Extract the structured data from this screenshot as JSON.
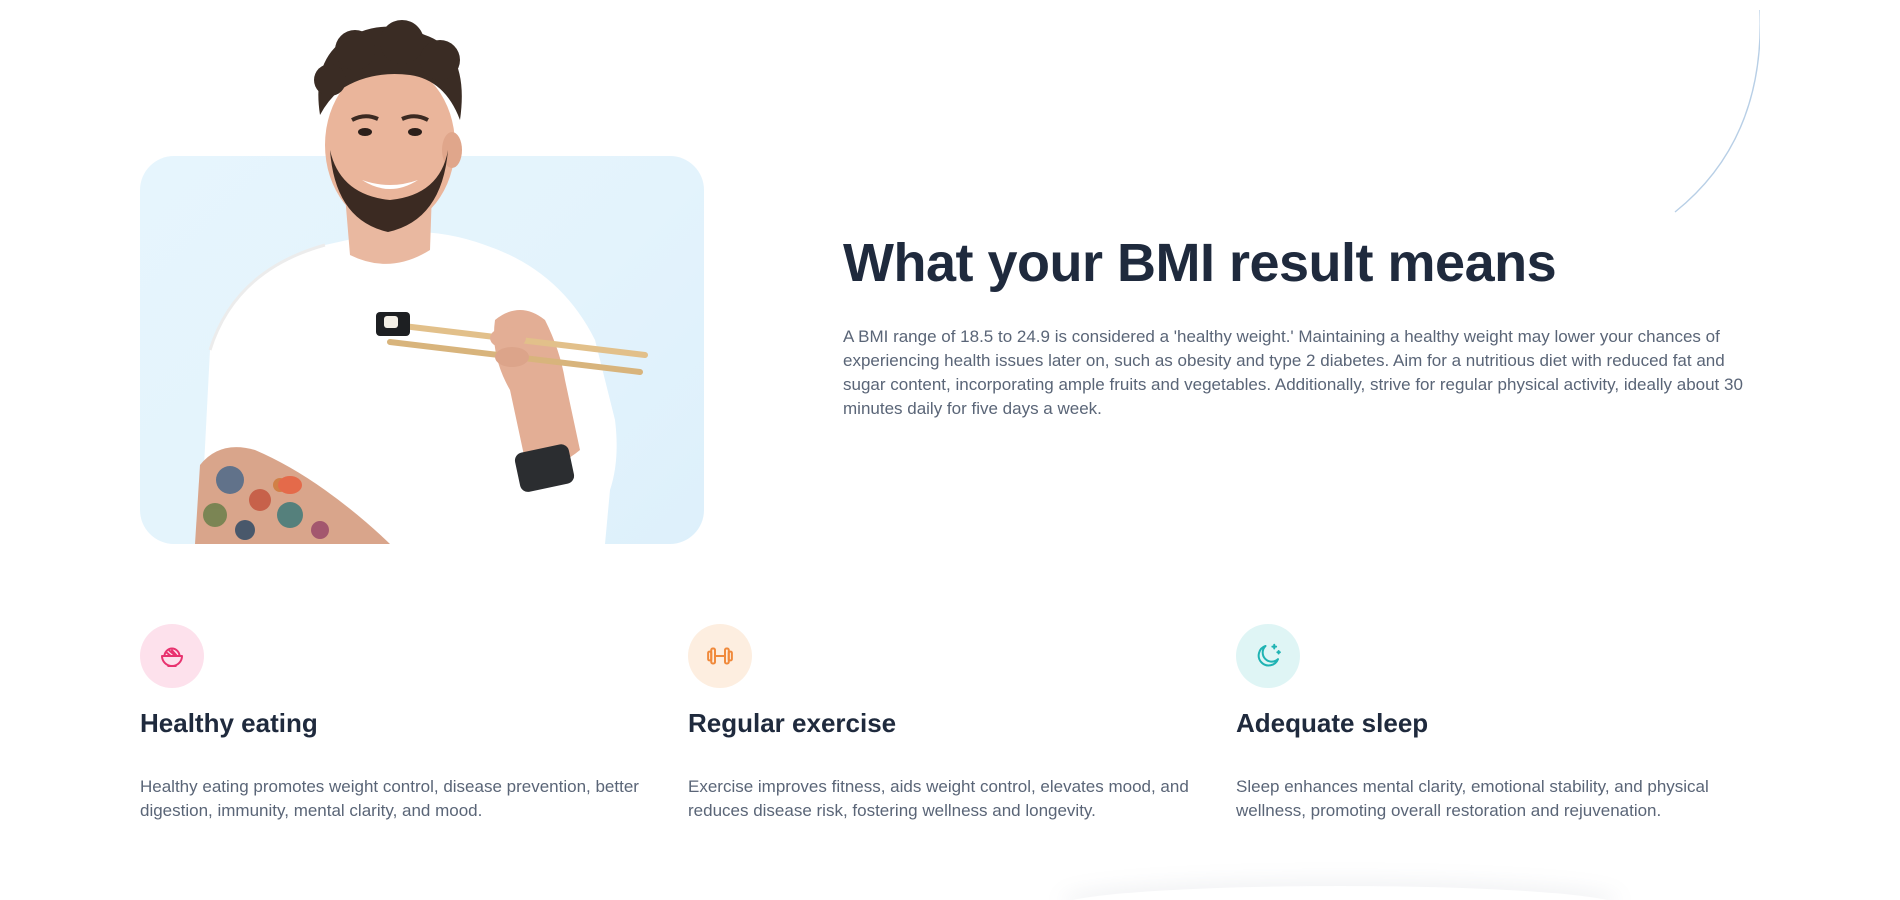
{
  "hero": {
    "title": "What your BMI result means",
    "description": "A BMI range of 18.5 to 24.9 is considered a 'healthy weight.' Maintaining a healthy weight may lower your chances of experiencing health issues later on, such as obesity and type 2 diabetes. Aim for a nutritious diet with reduced fat and sugar content, incorporating ample fruits and vegetables. Additionally, strive for regular physical activity, ideally about 30 minutes daily for five days a week.",
    "image": "smiling-man-with-chopsticks-photo"
  },
  "features": [
    {
      "icon": "bowl-icon",
      "icon_color": "#e8336f",
      "icon_bg": "#fde1ec",
      "title": "Healthy eating",
      "text": "Healthy eating promotes weight control, disease prevention, better digestion, immunity, mental clarity, and mood."
    },
    {
      "icon": "dumbbell-icon",
      "icon_color": "#f08a3c",
      "icon_bg": "#fdeee0",
      "title": "Regular exercise",
      "text": "Exercise improves fitness, aids weight control, elevates mood, and reduces disease risk, fostering wellness and longevity."
    },
    {
      "icon": "moon-stars-icon",
      "icon_color": "#1fb3b3",
      "icon_bg": "#dff5f5",
      "title": "Adequate sleep",
      "text": "Sleep enhances mental clarity, emotional stability, and physical wellness, promoting overall restoration and rejuvenation."
    }
  ],
  "colors": {
    "heading": "#1f2a3d",
    "body_text": "#5a6577",
    "card_bg": "#e4f4fc",
    "arc": "#b8cfe6"
  }
}
